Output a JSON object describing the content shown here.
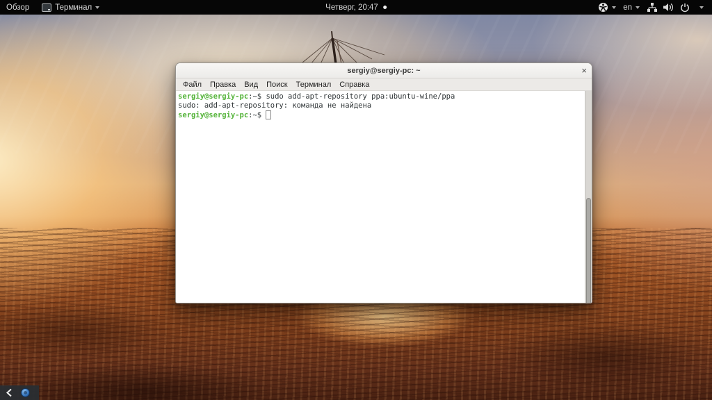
{
  "colors": {
    "topbar_bg": "#060606",
    "prompt_green": "#55b43a",
    "terminal_text": "#2e3436",
    "terminal_bg": "#ffffff",
    "titlebar_bg": "#f3f2f0"
  },
  "top_bar": {
    "activities": "Обзор",
    "app_name": "Терминал",
    "clock": "Четверг, 20:47",
    "keyboard_layout": "en"
  },
  "window": {
    "title": "sergiy@sergiy-pc: ~",
    "close": "×",
    "menu": [
      "Файл",
      "Правка",
      "Вид",
      "Поиск",
      "Терминал",
      "Справка"
    ]
  },
  "terminal": {
    "line1": {
      "user": "sergiy@sergiy-pc",
      "sep": ":~$ ",
      "command": "sudo add-apt-repository ppa:ubuntu-wine/ppa"
    },
    "line2": "sudo: add-apt-repository: команда не найдена",
    "line3": {
      "user": "sergiy@sergiy-pc",
      "sep": ":~$ "
    }
  }
}
